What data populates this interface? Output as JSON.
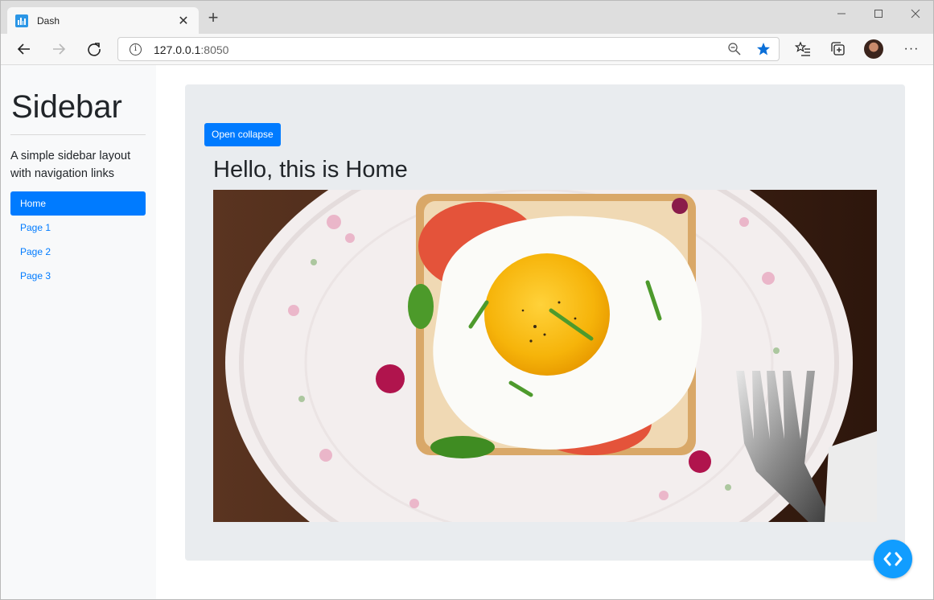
{
  "browser": {
    "tab_title": "Dash",
    "tab_close": "✕",
    "new_tab": "+",
    "url_host": "127.0.0.1",
    "url_port": ":8050",
    "minimize": "—",
    "maximize": "☐",
    "close": "✕",
    "more": "···"
  },
  "sidebar": {
    "title": "Sidebar",
    "lead": "A simple sidebar layout with navigation links",
    "items": [
      {
        "label": "Home",
        "active": true
      },
      {
        "label": "Page 1",
        "active": false
      },
      {
        "label": "Page 2",
        "active": false
      },
      {
        "label": "Page 3",
        "active": false
      }
    ]
  },
  "main": {
    "collapse_button": "Open collapse",
    "heading": "Hello, this is Home"
  },
  "colors": {
    "primary": "#007bff",
    "content_bg": "#e9ecef",
    "sidebar_bg": "#f8f9fa",
    "fab": "#119dff",
    "star": "#0a6fd8"
  },
  "icons": {
    "favicon": "bar-chart-icon",
    "back": "arrow-left-icon",
    "forward": "arrow-right-icon",
    "reload": "reload-icon",
    "site_info": "info-icon",
    "zoom": "zoom-out-icon",
    "favorite": "star-icon",
    "favorites_list": "favorites-list-icon",
    "collections": "collections-icon",
    "profile": "avatar",
    "menu": "more-icon",
    "dev_tools": "code-brackets-icon"
  }
}
